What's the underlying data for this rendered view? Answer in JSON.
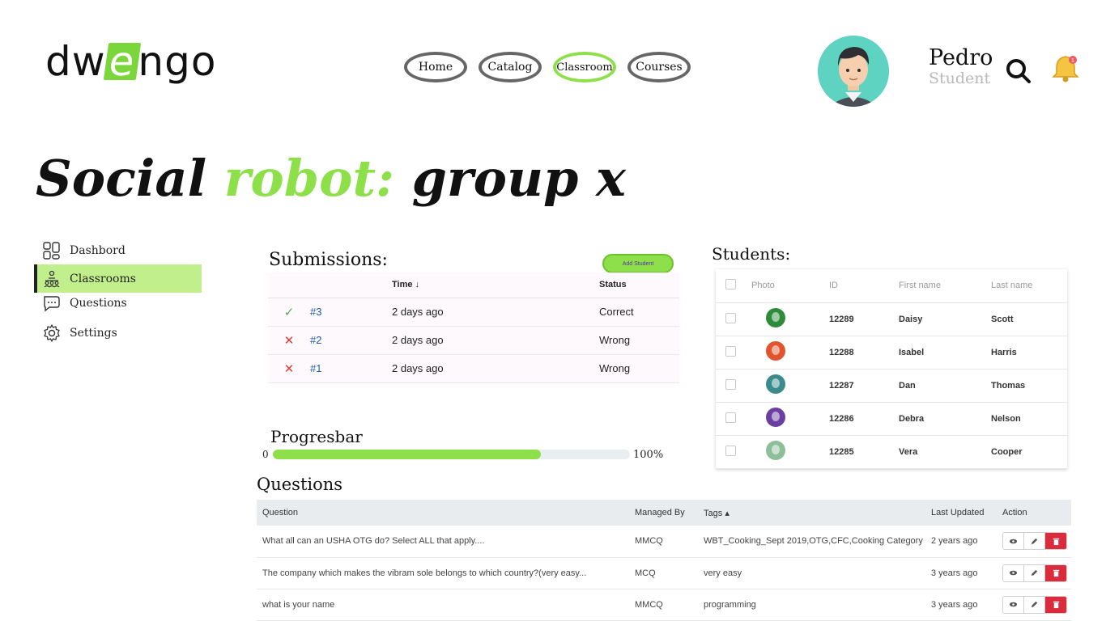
{
  "brand": {
    "logo_pre": "dw",
    "logo_e": "e",
    "logo_post": "ngo"
  },
  "nav": {
    "home": "Home",
    "catalog": "Catalog",
    "classroom": "Classroom",
    "courses": "Courses"
  },
  "user": {
    "name": "Pedro",
    "role": "Student",
    "notifications": "1"
  },
  "title": {
    "part1": "Social ",
    "accent": "robot:",
    "part2": " group x"
  },
  "sidebar": {
    "items": [
      {
        "label": "Dashbord",
        "icon": "dashboard-icon",
        "active": false
      },
      {
        "label": "Classrooms",
        "icon": "classroom-icon",
        "active": true
      },
      {
        "label": "Questions",
        "icon": "chat-icon",
        "active": false
      },
      {
        "label": "Settings",
        "icon": "gear-icon",
        "active": false
      }
    ]
  },
  "submissions": {
    "title": "Submissions:",
    "add_button": "Add Student",
    "columns": {
      "time": "Time",
      "status": "Status"
    },
    "rows": [
      {
        "mark": "✓",
        "result": "ok",
        "id": "#3",
        "time": "2 days ago",
        "status": "Correct"
      },
      {
        "mark": "✕",
        "result": "bad",
        "id": "#2",
        "time": "2 days ago",
        "status": "Wrong"
      },
      {
        "mark": "✕",
        "result": "bad",
        "id": "#1",
        "time": "2 days ago",
        "status": "Wrong"
      }
    ]
  },
  "progress": {
    "title": "Progresbar",
    "min": "0",
    "max": "100%",
    "value_percent": 75
  },
  "students": {
    "title": "Students:",
    "columns": {
      "photo": "Photo",
      "id": "ID",
      "first": "First name",
      "last": "Last name"
    },
    "rows": [
      {
        "id": "12289",
        "first": "Daisy",
        "last": "Scott",
        "color": "#2e8b3a"
      },
      {
        "id": "12288",
        "first": "Isabel",
        "last": "Harris",
        "color": "#e0542e"
      },
      {
        "id": "12287",
        "first": "Dan",
        "last": "Thomas",
        "color": "#3b8a8c"
      },
      {
        "id": "12286",
        "first": "Debra",
        "last": "Nelson",
        "color": "#6a3fa0"
      },
      {
        "id": "12285",
        "first": "Vera",
        "last": "Cooper",
        "color": "#8fbf9a"
      }
    ]
  },
  "questions": {
    "title": "Questions",
    "columns": {
      "question": "Question",
      "managed": "Managed By",
      "tags": "Tags",
      "updated": "Last Updated",
      "action": "Action"
    },
    "rows": [
      {
        "question": "What all can an USHA OTG do? Select ALL that apply....",
        "managed": "MMCQ",
        "tags": "WBT_Cooking_Sept 2019,OTG,CFC,Cooking Category",
        "updated": "2 years ago"
      },
      {
        "question": "The company which makes the vibram sole belongs to which country?(very easy...",
        "managed": "MCQ",
        "tags": "very easy",
        "updated": "3 years ago"
      },
      {
        "question": "what is your name",
        "managed": "MMCQ",
        "tags": "programming",
        "updated": "3 years ago"
      }
    ]
  },
  "colors": {
    "accent": "#8ee04a",
    "active_bg": "#c1ef8c",
    "danger": "#dc2b3c",
    "link": "#1e5aa8"
  }
}
